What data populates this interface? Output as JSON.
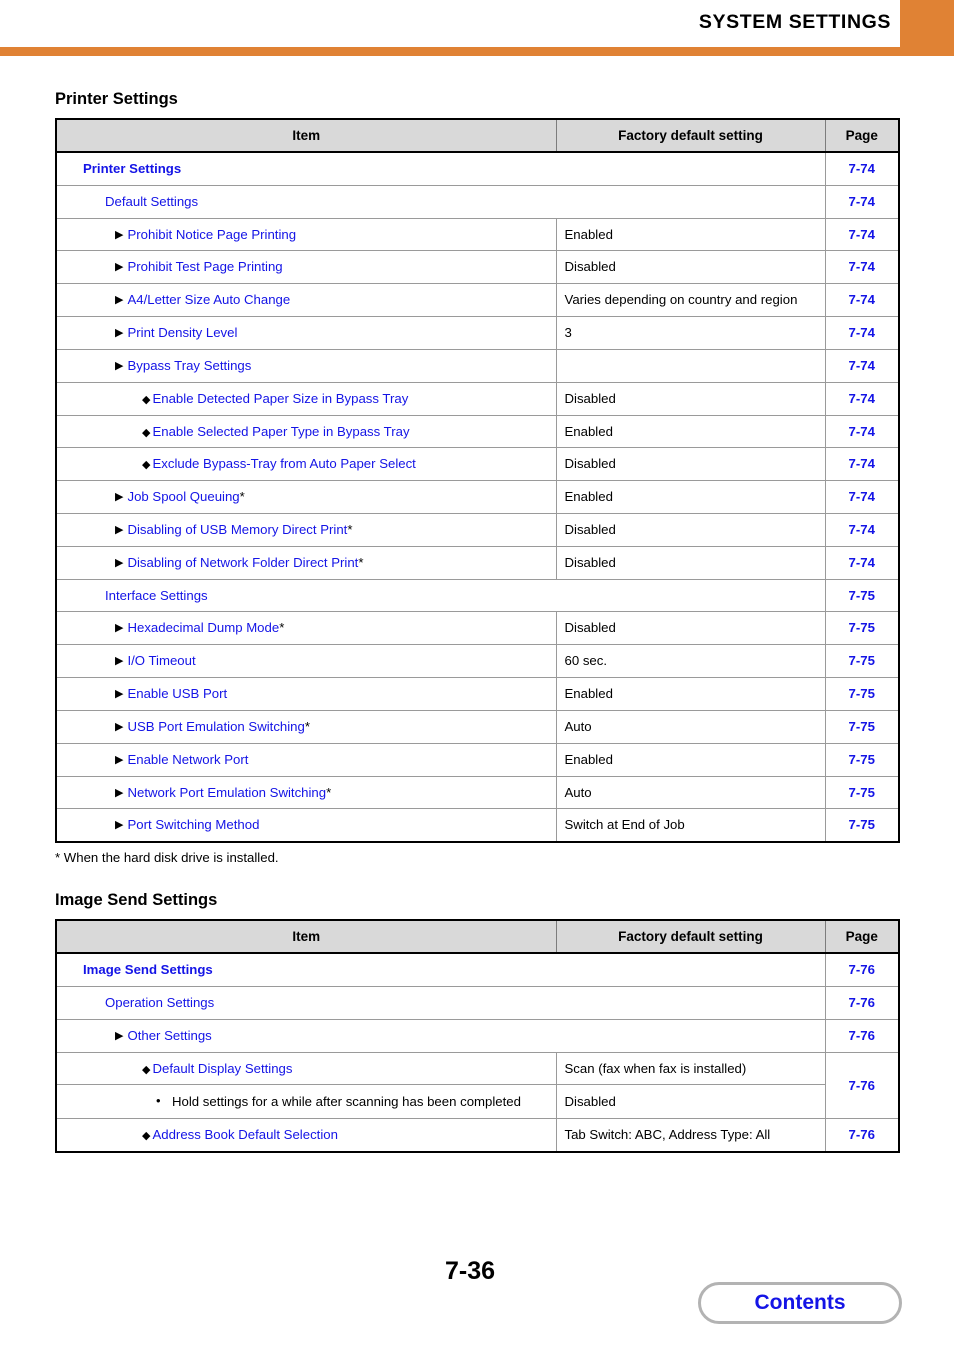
{
  "header": {
    "title": "SYSTEM SETTINGS",
    "accent_color": "#e08234"
  },
  "link_color": "#1414e6",
  "columns": {
    "item": "Item",
    "default": "Factory default setting",
    "page": "Page"
  },
  "printer_section": {
    "title": "Printer Settings",
    "footnote": "*  When the hard disk drive is installed.",
    "rows": [
      {
        "level": 1,
        "label": "Printer Settings",
        "star": "",
        "value": null,
        "page": "7-74"
      },
      {
        "level": 2,
        "label": "Default Settings",
        "star": "",
        "value": null,
        "page": "7-74"
      },
      {
        "level": 3,
        "label": "Prohibit Notice Page Printing",
        "star": "",
        "value": "Enabled",
        "page": "7-74"
      },
      {
        "level": 3,
        "label": "Prohibit Test Page Printing",
        "star": "",
        "value": "Disabled",
        "page": "7-74"
      },
      {
        "level": 3,
        "label": "A4/Letter Size Auto Change",
        "star": "",
        "value": "Varies depending on country and region",
        "page": "7-74"
      },
      {
        "level": 3,
        "label": "Print Density Level",
        "star": "",
        "value": "3",
        "page": "7-74"
      },
      {
        "level": 3,
        "label": "Bypass Tray Settings",
        "star": "",
        "value": "",
        "page": "7-74"
      },
      {
        "level": 4,
        "label": "Enable Detected Paper Size in Bypass Tray",
        "star": "",
        "value": "Disabled",
        "page": "7-74"
      },
      {
        "level": 4,
        "label": "Enable Selected Paper Type in Bypass Tray",
        "star": "",
        "value": "Enabled",
        "page": "7-74"
      },
      {
        "level": 4,
        "label": "Exclude Bypass-Tray from Auto Paper Select",
        "star": "",
        "value": "Disabled",
        "page": "7-74"
      },
      {
        "level": 3,
        "label": "Job Spool Queuing",
        "star": "*",
        "value": "Enabled",
        "page": "7-74"
      },
      {
        "level": 3,
        "label": "Disabling of USB Memory Direct Print",
        "star": "*",
        "value": "Disabled",
        "page": "7-74"
      },
      {
        "level": 3,
        "label": "Disabling of Network Folder Direct Print",
        "star": "*",
        "value": "Disabled",
        "page": "7-74"
      },
      {
        "level": 2,
        "label": "Interface Settings",
        "star": "",
        "value": null,
        "page": "7-75"
      },
      {
        "level": 3,
        "label": "Hexadecimal Dump Mode",
        "star": "*",
        "value": "Disabled",
        "page": "7-75"
      },
      {
        "level": 3,
        "label": "I/O Timeout",
        "star": "",
        "value": "60 sec.",
        "page": "7-75"
      },
      {
        "level": 3,
        "label": "Enable USB Port",
        "star": "",
        "value": "Enabled",
        "page": "7-75"
      },
      {
        "level": 3,
        "label": "USB Port Emulation Switching",
        "star": "*",
        "value": "Auto",
        "page": "7-75"
      },
      {
        "level": 3,
        "label": "Enable Network Port",
        "star": "",
        "value": "Enabled",
        "page": "7-75"
      },
      {
        "level": 3,
        "label": "Network Port Emulation Switching",
        "star": "*",
        "value": "Auto",
        "page": "7-75"
      },
      {
        "level": 3,
        "label": "Port Switching Method",
        "star": "",
        "value": "Switch at End of Job",
        "page": "7-75"
      }
    ]
  },
  "image_send_section": {
    "title": "Image Send Settings",
    "rows": [
      {
        "level": 1,
        "label": "Image Send Settings",
        "star": "",
        "value": null,
        "page": "7-76"
      },
      {
        "level": 2,
        "label": "Operation Settings",
        "star": "",
        "value": null,
        "page": "7-76"
      },
      {
        "level": 3,
        "label": "Other Settings",
        "star": "",
        "value": null,
        "page": "7-76"
      },
      {
        "level": 4,
        "label": "Default Display Settings",
        "star": "",
        "value": "Scan (fax when fax is installed)",
        "page": "7-76",
        "page_rowspan": 2
      },
      {
        "level": 5,
        "label": "Hold settings for a while after scanning has been completed",
        "star": "",
        "value": "Disabled",
        "page": null
      },
      {
        "level": 4,
        "label": "Address Book Default Selection",
        "star": "",
        "value": "Tab Switch: ABC, Address Type: All",
        "page": "7-76"
      }
    ]
  },
  "footer": {
    "page_number": "7-36",
    "contents_label": "Contents"
  }
}
